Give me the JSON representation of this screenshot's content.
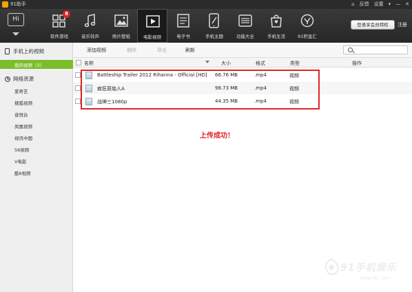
{
  "titlebar": {
    "app_title": "91助手",
    "feedback": "反馈",
    "settings": "设置",
    "menu_glyph": "▾",
    "minimize_glyph": "—",
    "close_glyph": "✕"
  },
  "toolbar": {
    "hi_label": "Hi",
    "tools": [
      {
        "label": "软件游戏",
        "icon": "apps-grid-icon",
        "badge": "8"
      },
      {
        "label": "音乐铃声",
        "icon": "music-note-icon"
      },
      {
        "label": "照片壁纸",
        "icon": "photo-icon"
      },
      {
        "label": "电影视频",
        "icon": "video-icon",
        "active": true
      },
      {
        "label": "电子书",
        "icon": "ebook-icon"
      },
      {
        "label": "手机主题",
        "icon": "phone-theme-icon"
      },
      {
        "label": "功能大全",
        "icon": "features-icon"
      },
      {
        "label": "手机生活",
        "icon": "shopping-bag-icon"
      },
      {
        "label": "91积金汇",
        "icon": "coin-icon"
      }
    ],
    "vip_button": "登录享会员特权",
    "register": "注册"
  },
  "sidebar": {
    "phone_section": "手机上的视频",
    "my_videos": "我的视频（3）",
    "network_section": "网络资源",
    "network_items": [
      "爱奇艺",
      "搜狐视频",
      "音悦台",
      "凤凰视频",
      "视讯中国",
      "56视频",
      "V电影",
      "酷6视频"
    ]
  },
  "actions": {
    "add": "添加视频",
    "delete": "删除",
    "export": "导出",
    "refresh": "刷新",
    "search_placeholder": ""
  },
  "table": {
    "headers": {
      "name": "名称",
      "size": "大小",
      "format": "格式",
      "type": "类型",
      "ops": "操作"
    },
    "rows": [
      {
        "name": "Battleship Trailer 2012 Rihanna - Official [HD]",
        "size": "66.76 MB",
        "format": ".mp4",
        "type": "视频"
      },
      {
        "name": "疯狂原始人A",
        "size": "98.73 MB",
        "format": ".mp4",
        "type": "视频"
      },
      {
        "name": "战神三1080p",
        "size": "44.35 MB",
        "format": ".mp4",
        "type": "视频"
      }
    ]
  },
  "annotation": {
    "success_text": "上传成功！"
  },
  "watermark": {
    "main": "91手机娱乐",
    "sub": "www.91.com"
  },
  "colors": {
    "accent_green": "#7cbd2b",
    "highlight_red": "#e02424",
    "toolbar_dark": "#2b2b2b"
  }
}
